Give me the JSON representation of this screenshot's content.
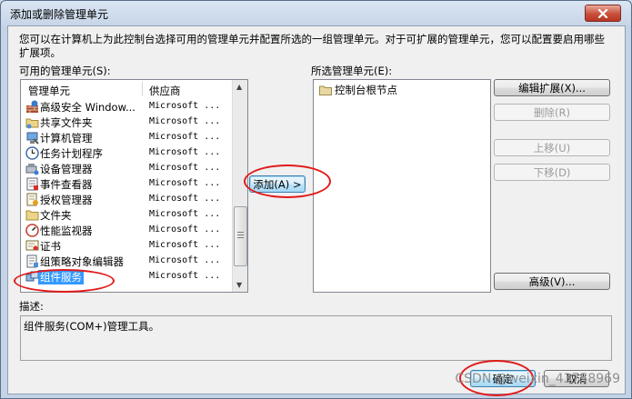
{
  "window": {
    "title": "添加或删除管理单元"
  },
  "intro_text": "您可以在计算机上为此控制台选择可用的管理单元并配置所选的一组管理单元。对于可扩展的管理单元，您可以配置要启用哪些扩展项。",
  "available": {
    "label": "可用的管理单元(S):",
    "col_name": "管理单元",
    "col_vendor": "供应商",
    "items": [
      {
        "name": "高级安全 Window...",
        "vendor": "Microsoft ...",
        "icon": "firewall-icon"
      },
      {
        "name": "共享文件夹",
        "vendor": "Microsoft ...",
        "icon": "shared-folder-icon"
      },
      {
        "name": "计算机管理",
        "vendor": "Microsoft ...",
        "icon": "computer-management-icon"
      },
      {
        "name": "任务计划程序",
        "vendor": "Microsoft ...",
        "icon": "task-scheduler-icon"
      },
      {
        "name": "设备管理器",
        "vendor": "Microsoft ...",
        "icon": "device-manager-icon"
      },
      {
        "name": "事件查看器",
        "vendor": "Microsoft ...",
        "icon": "event-viewer-icon"
      },
      {
        "name": "授权管理器",
        "vendor": "Microsoft ...",
        "icon": "authorization-manager-icon"
      },
      {
        "name": "文件夹",
        "vendor": "Microsoft ...",
        "icon": "folder-icon"
      },
      {
        "name": "性能监视器",
        "vendor": "Microsoft ...",
        "icon": "performance-monitor-icon"
      },
      {
        "name": "证书",
        "vendor": "Microsoft ...",
        "icon": "certificate-icon"
      },
      {
        "name": "组策略对象编辑器",
        "vendor": "Microsoft ...",
        "icon": "group-policy-icon"
      },
      {
        "name": "组件服务",
        "vendor": "Microsoft ...",
        "icon": "component-services-icon",
        "selected": true
      }
    ]
  },
  "add_button": {
    "label": "添加(A) >"
  },
  "selected": {
    "label": "所选管理单元(E):",
    "root": "控制台根节点"
  },
  "side_buttons": {
    "edit_extensions": "编辑扩展(X)...",
    "remove": "删除(R)",
    "move_up": "上移(U)",
    "move_down": "下移(D)",
    "advanced": "高级(V)..."
  },
  "description": {
    "label": "描述:",
    "text": "组件服务(COM+)管理工具。"
  },
  "footer": {
    "ok": "确定",
    "cancel": "取消"
  },
  "watermark": "CSDN @weixin_43758969",
  "colors": {
    "selection": "#3399ff",
    "annotation": "#e21a1a"
  }
}
